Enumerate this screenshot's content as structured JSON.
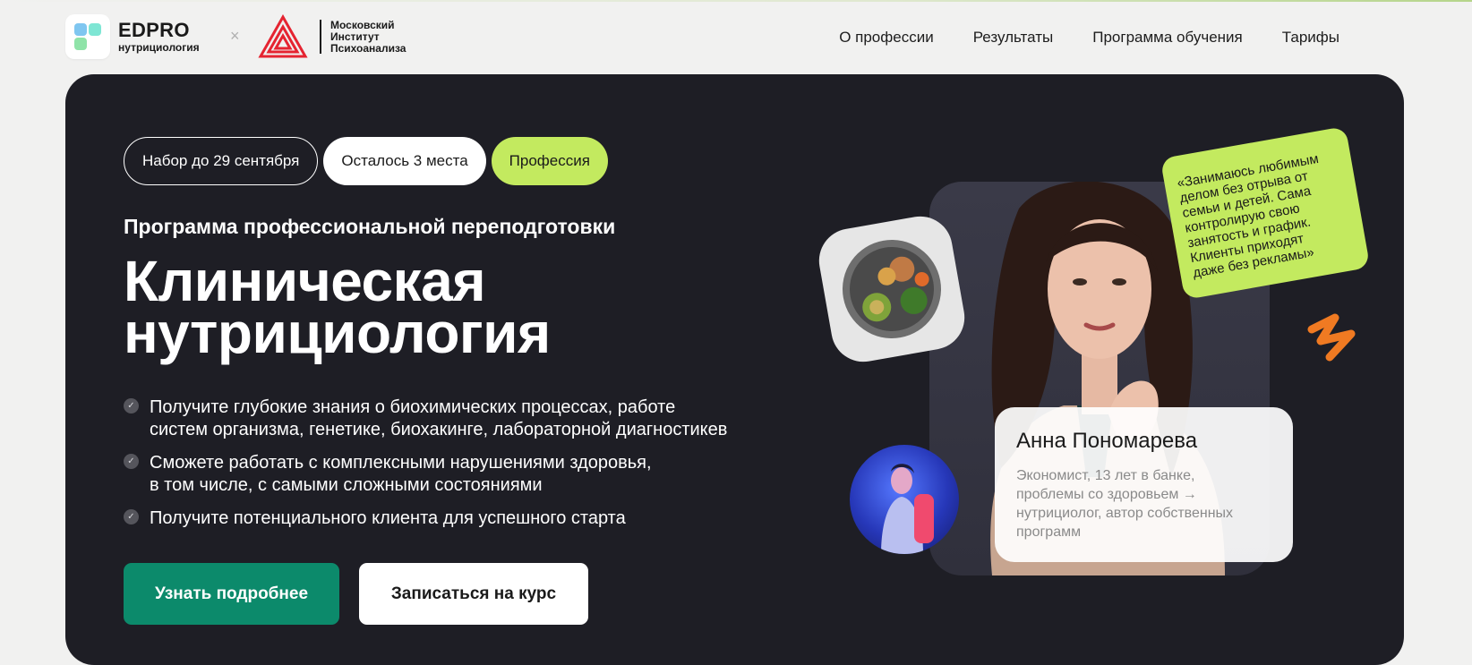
{
  "header": {
    "brand_name": "EDPRO",
    "brand_sub": "нутрициология",
    "separator": "×",
    "partner": {
      "line1": "Московский",
      "line2": "Институт",
      "line3": "Психоанализа"
    },
    "nav": [
      {
        "label": "О профессии"
      },
      {
        "label": "Результаты"
      },
      {
        "label": "Программа обучения"
      },
      {
        "label": "Тарифы"
      }
    ]
  },
  "hero": {
    "pills": [
      {
        "label": "Набор до 29 сентября"
      },
      {
        "label": "Осталось 3 места"
      },
      {
        "label": "Профессия"
      }
    ],
    "subtitle": "Программа профессиональной переподготовки",
    "title_line1": "Клиническая",
    "title_line2": "нутрициология",
    "bullets": [
      {
        "text": "Получите глубокие знания о биохимических процессах, работе\nсистем организма, генетике, биохакинге, лабораторной диагностикев"
      },
      {
        "text": "Сможете работать с комплексными нарушениями здоровья,\nв том числе, с самыми сложными состояниями"
      },
      {
        "text": "Получите потенциального клиента для успешного старта"
      }
    ],
    "buttons": {
      "primary": "Узнать подробнее",
      "secondary": "Записаться на курс"
    },
    "quote": "«Занимаюсь любимым\nделом без отрыва от\nсемьи и детей. Сама\nконтролирую свою\nзанятость и график.\nКлиенты приходят\nдаже без рекламы»",
    "card": {
      "name": "Анна Пономарева",
      "description": "Экономист, 13 лет в банке,\nпроблемы со здоровьем →\nнутрициолог, автор собственных\nпрограмм"
    }
  },
  "colors": {
    "hero_bg": "#1e1e25",
    "accent_green": "#c3ea5f",
    "primary_button": "#0c8a6b",
    "page_bg": "#f1f1f0"
  },
  "icons": [
    "edpro-logo-icon",
    "mip-logo-icon",
    "check-icon",
    "zigzag-decor-icon"
  ]
}
